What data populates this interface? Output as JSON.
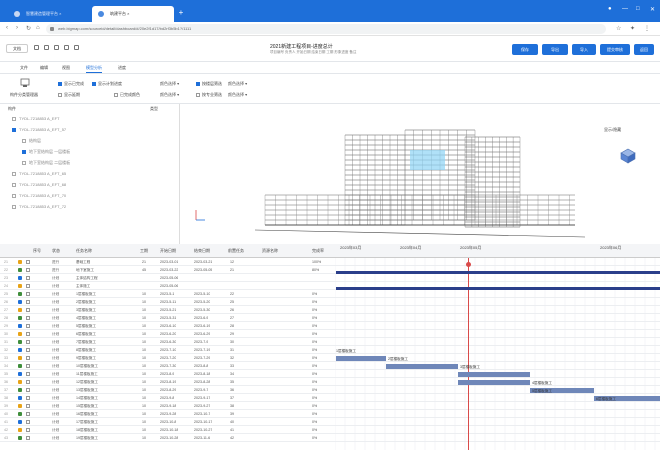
{
  "browser": {
    "tabs": [
      {
        "label": "智慧建造管理平台 ×"
      },
      {
        "label": "筑建平台 ×"
      }
    ],
    "url": "web.bigmap.com/sourceid/detail/dashboard/#/20e2f1d17/bd2rf3b5b1?/1111"
  },
  "app": {
    "doc_label": "文档",
    "project_title": "2021新建工程项目-进度总计",
    "project_subtitle": "项目编号  负责人  开始日期  结束日期  工期  形象进度  备注",
    "buttons": [
      "保存",
      "导出",
      "导入",
      "提交审核",
      "返回"
    ]
  },
  "menu": {
    "tabs": [
      "文件",
      "编辑",
      "视图",
      "模型分析",
      "进度"
    ],
    "active_index": 3
  },
  "toolbar": {
    "left_label": "构件分类管理器",
    "check1": "显示已完成",
    "check2": "显示延期",
    "check3": "显示计划进度",
    "check4": "已完成颜色",
    "dd1": "颜色选择",
    "dd2": "颜色选择",
    "dd3": "颜色选择",
    "dd4": "颜色选择",
    "opt1": "按楼层筛选",
    "opt2": "按专业筛选",
    "opt3": "显示模式",
    "opt4": "动画播放"
  },
  "tree": {
    "header": "构件",
    "header2": "类型",
    "nodes": [
      {
        "label": "TYDL-7218853 A_EFT",
        "on": false
      },
      {
        "label": "TYDL-7218853 A_EFT_57",
        "on": true
      },
      {
        "label": "结构层",
        "on": false
      },
      {
        "label": "地下室结构层 一层楼板",
        "on": true
      },
      {
        "label": "地下室结构层 二层楼板",
        "on": false
      },
      {
        "label": "TYDL-7218853 A_EFT_65",
        "on": false
      },
      {
        "label": "TYDL-7218853 A_EFT_68",
        "on": false
      },
      {
        "label": "TYDL-7218853 A_EFT_70",
        "on": false
      },
      {
        "label": "TYDL-7218853 A_EFT_72",
        "on": false
      }
    ]
  },
  "viewer": {
    "view_label": "显示/隐藏"
  },
  "gantt": {
    "headers": [
      "",
      "序号",
      "状态",
      "任务名称",
      "工期",
      "开始日期",
      "结束日期",
      "前置任务",
      "资源名称",
      "完成率"
    ],
    "timeline": [
      "2023年03月",
      "2023年04月",
      "2023年05月",
      "2023年06月"
    ],
    "rows": [
      {
        "n": "21",
        "status": "进行",
        "name": "基础工程",
        "dur": "21",
        "start": "2023-03-01",
        "end": "2023-03-21",
        "pre": "12",
        "pct": "100%"
      },
      {
        "n": "22",
        "status": "进行",
        "name": "地下室施工",
        "dur": "45",
        "start": "2023-03-22",
        "end": "2023-05-05",
        "pre": "21",
        "pct": "80%"
      },
      {
        "n": "23",
        "status": "计划",
        "name": "主体结构工程",
        "dur": "",
        "start": "2023-05-06",
        "end": "",
        "pre": "",
        "pct": ""
      },
      {
        "n": "24",
        "status": "计划",
        "name": "主体施工",
        "dur": "",
        "start": "2023-05-06",
        "end": "",
        "pre": "",
        "pct": ""
      },
      {
        "n": "25",
        "status": "计划",
        "name": "1层楼板施工",
        "dur": "10",
        "start": "2023-5-1",
        "end": "2023-5-10",
        "pre": "22",
        "pct": "0%"
      },
      {
        "n": "26",
        "status": "计划",
        "name": "2层楼板施工",
        "dur": "10",
        "start": "2023-5-11",
        "end": "2023-5-20",
        "pre": "25",
        "pct": "0%"
      },
      {
        "n": "27",
        "status": "计划",
        "name": "3层楼板施工",
        "dur": "10",
        "start": "2023-5-21",
        "end": "2023-5-30",
        "pre": "26",
        "pct": "0%"
      },
      {
        "n": "28",
        "status": "计划",
        "name": "4层楼板施工",
        "dur": "10",
        "start": "2023-5-31",
        "end": "2023-6-9",
        "pre": "27",
        "pct": "0%"
      },
      {
        "n": "29",
        "status": "计划",
        "name": "5层楼板施工",
        "dur": "10",
        "start": "2023-6-10",
        "end": "2023-6-19",
        "pre": "28",
        "pct": "0%"
      },
      {
        "n": "30",
        "status": "计划",
        "name": "6层楼板施工",
        "dur": "10",
        "start": "2023-6-20",
        "end": "2023-6-29",
        "pre": "29",
        "pct": "0%"
      },
      {
        "n": "31",
        "status": "计划",
        "name": "7层楼板施工",
        "dur": "10",
        "start": "2023-6-30",
        "end": "2023-7-9",
        "pre": "30",
        "pct": "0%"
      },
      {
        "n": "32",
        "status": "计划",
        "name": "8层楼板施工",
        "dur": "10",
        "start": "2023-7-10",
        "end": "2023-7-19",
        "pre": "31",
        "pct": "0%"
      },
      {
        "n": "33",
        "status": "计划",
        "name": "9层楼板施工",
        "dur": "10",
        "start": "2023-7-20",
        "end": "2023-7-29",
        "pre": "32",
        "pct": "0%"
      },
      {
        "n": "34",
        "status": "计划",
        "name": "10层楼板施工",
        "dur": "10",
        "start": "2023-7-30",
        "end": "2023-8-8",
        "pre": "33",
        "pct": "0%"
      },
      {
        "n": "35",
        "status": "计划",
        "name": "11层楼板施工",
        "dur": "10",
        "start": "2023-8-9",
        "end": "2023-8-18",
        "pre": "34",
        "pct": "0%"
      },
      {
        "n": "36",
        "status": "计划",
        "name": "12层楼板施工",
        "dur": "10",
        "start": "2023-8-19",
        "end": "2023-8-28",
        "pre": "35",
        "pct": "0%"
      },
      {
        "n": "37",
        "status": "计划",
        "name": "13层楼板施工",
        "dur": "10",
        "start": "2023-8-29",
        "end": "2023-9-7",
        "pre": "36",
        "pct": "0%"
      },
      {
        "n": "38",
        "status": "计划",
        "name": "14层楼板施工",
        "dur": "10",
        "start": "2023-9-8",
        "end": "2023-9-17",
        "pre": "37",
        "pct": "0%"
      },
      {
        "n": "39",
        "status": "计划",
        "name": "15层楼板施工",
        "dur": "10",
        "start": "2023-9-18",
        "end": "2023-9-27",
        "pre": "38",
        "pct": "0%"
      },
      {
        "n": "40",
        "status": "计划",
        "name": "16层楼板施工",
        "dur": "10",
        "start": "2023-9-28",
        "end": "2023-10-7",
        "pre": "39",
        "pct": "0%"
      },
      {
        "n": "41",
        "status": "计划",
        "name": "17层楼板施工",
        "dur": "10",
        "start": "2023-10-8",
        "end": "2023-10-17",
        "pre": "40",
        "pct": "0%"
      },
      {
        "n": "42",
        "status": "计划",
        "name": "18层楼板施工",
        "dur": "10",
        "start": "2023-10-18",
        "end": "2023-10-27",
        "pre": "41",
        "pct": "0%"
      },
      {
        "n": "43",
        "status": "计划",
        "name": "19层楼板施工",
        "dur": "10",
        "start": "2023-10-28",
        "end": "2023-11-6",
        "pre": "42",
        "pct": "0%"
      }
    ],
    "bar_labels": [
      "1层楼板施工",
      "2层楼板施工",
      "3层楼板施工",
      "4层楼板施工",
      "5层楼板施工",
      "6层楼板施工"
    ]
  },
  "colors": {
    "accent": "#1e6fd9",
    "today": "#d94a4a",
    "bar": "#6f87b9",
    "summary_bar": "#2a3e8a"
  }
}
